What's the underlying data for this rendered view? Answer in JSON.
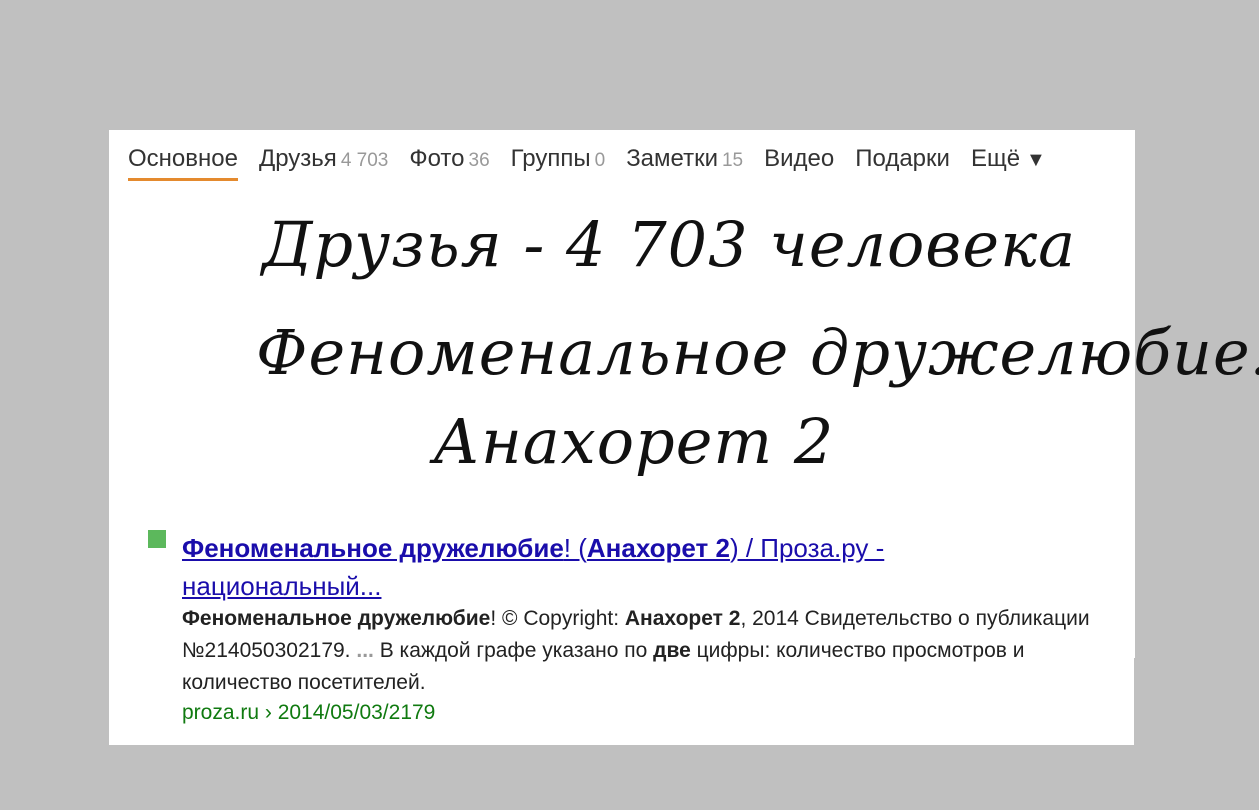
{
  "tabs": [
    {
      "label": "Основное",
      "count": ""
    },
    {
      "label": "Друзья",
      "count": "4 703"
    },
    {
      "label": "Фото",
      "count": "36"
    },
    {
      "label": "Группы",
      "count": "0"
    },
    {
      "label": "Заметки",
      "count": "15"
    },
    {
      "label": "Видео",
      "count": ""
    },
    {
      "label": "Подарки",
      "count": ""
    },
    {
      "label": "Ещё",
      "count": ""
    }
  ],
  "more_arrow": "▼",
  "headline": {
    "line1": "Друзья - 4 703 человека",
    "line2": "Феноменальное дружелюбие!",
    "line3": "Анахорет 2"
  },
  "result": {
    "title": {
      "b1": "Феноменальное дружелюбие",
      "t1": "! (",
      "b2": "Анахорет 2",
      "t2": ") / Проза.ру - национальный..."
    },
    "snippet": {
      "b1": "Феноменальное дружелюбие",
      "t1": "! © Copyright: ",
      "b2": "Анахорет 2",
      "t2": ", 2014 Свидетельство о публикации №214050302179. ",
      "ellipsis": "...",
      "t3": " В каждой графе указано по ",
      "b3": "две",
      "t4": " цифры: количество просмотров и количество посетителей."
    },
    "url": "proza.ru › 2014/05/03/2179"
  },
  "colors": {
    "background": "#c0c0c0",
    "panel": "#ffffff",
    "active_tab_underline": "#e48a2e",
    "link": "#1a0dab",
    "url": "#107a10",
    "bullet": "#5cb85c"
  }
}
